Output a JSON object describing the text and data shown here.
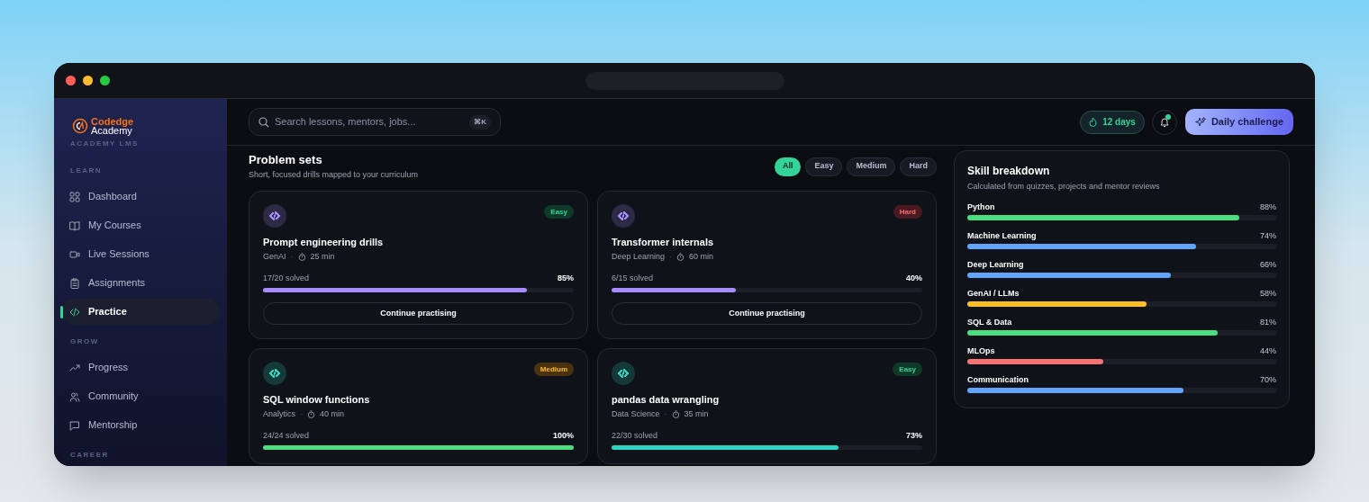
{
  "brand": {
    "name_top": "Codedge",
    "name_bottom": "Academy",
    "subtitle": "ACADEMY LMS"
  },
  "sidebar": {
    "sections": [
      {
        "label": "LEARN",
        "items": [
          {
            "label": "Dashboard",
            "selected": false
          },
          {
            "label": "My Courses",
            "selected": false
          },
          {
            "label": "Live Sessions",
            "selected": false
          },
          {
            "label": "Assignments",
            "selected": false
          },
          {
            "label": "Practice",
            "selected": true
          }
        ]
      },
      {
        "label": "GROW",
        "items": [
          {
            "label": "Progress",
            "selected": false
          },
          {
            "label": "Community",
            "selected": false
          },
          {
            "label": "Mentorship",
            "selected": false
          }
        ]
      },
      {
        "label": "CAREER"
      }
    ]
  },
  "topbar": {
    "search": {
      "placeholder": "Search lessons, mentors, jobs...",
      "shortcut": "⌘K"
    },
    "streak": "12 days",
    "notifications": {
      "unread": true
    },
    "cta": "Daily challenge"
  },
  "problem_sets": {
    "title": "Problem sets",
    "subtitle": "Short, focused drills mapped to your curriculum",
    "filters": [
      {
        "label": "All",
        "selected": true
      },
      {
        "label": "Easy",
        "selected": false
      },
      {
        "label": "Medium",
        "selected": false
      },
      {
        "label": "Hard",
        "selected": false
      }
    ],
    "cards": [
      {
        "icon": {
          "color": "#a78bfa"
        },
        "title": "Prompt engineering drills",
        "topic": "GenAI",
        "separator": "·",
        "duration": "25 min",
        "difficulty": {
          "kind": "easy",
          "label": "Easy"
        },
        "solved": "17/20 solved",
        "percent": "85%",
        "level": 0.85,
        "color": "#a78bfa",
        "button": "Continue practising"
      },
      {
        "icon": {
          "color": "#a78bfa"
        },
        "title": "Transformer internals",
        "topic": "Deep Learning",
        "separator": "·",
        "duration": "60 min",
        "difficulty": {
          "kind": "hard",
          "label": "Hard"
        },
        "solved": "6/15 solved",
        "percent": "40%",
        "level": 0.4,
        "color": "#a78bfa",
        "button": "Continue practising"
      },
      {
        "icon": {
          "color": "#2dd4bf"
        },
        "title": "SQL window functions",
        "topic": "Analytics",
        "separator": "·",
        "duration": "40 min",
        "difficulty": {
          "kind": "medium",
          "label": "Medium"
        },
        "solved": "24/24 solved",
        "percent": "100%",
        "level": 1,
        "color": "#4ade80"
      },
      {
        "icon": {
          "color": "#2dd4bf"
        },
        "title": "pandas data wrangling",
        "topic": "Data Science",
        "separator": "·",
        "duration": "35 min",
        "difficulty": {
          "kind": "easy",
          "label": "Easy"
        },
        "solved": "22/30 solved",
        "percent": "73%",
        "level": 0.73,
        "color": "#2dd4bf"
      }
    ]
  },
  "skills": {
    "title": "Skill breakdown",
    "subtitle": "Calculated from quizzes, projects and mentor reviews",
    "items": [
      {
        "name": "Python",
        "reading": "88%",
        "level": 0.88,
        "color": "#4ade80"
      },
      {
        "name": "Machine Learning",
        "reading": "74%",
        "level": 0.74,
        "color": "#60a5fa"
      },
      {
        "name": "Deep Learning",
        "reading": "66%",
        "level": 0.66,
        "color": "#60a5fa"
      },
      {
        "name": "GenAI / LLMs",
        "reading": "58%",
        "level": 0.58,
        "color": "#fbbf24"
      },
      {
        "name": "SQL & Data",
        "reading": "81%",
        "level": 0.81,
        "color": "#4ade80"
      },
      {
        "name": "MLOps",
        "reading": "44%",
        "level": 0.44,
        "color": "#f87171"
      },
      {
        "name": "Communication",
        "reading": "70%",
        "level": 0.7,
        "color": "#60a5fa"
      }
    ]
  }
}
